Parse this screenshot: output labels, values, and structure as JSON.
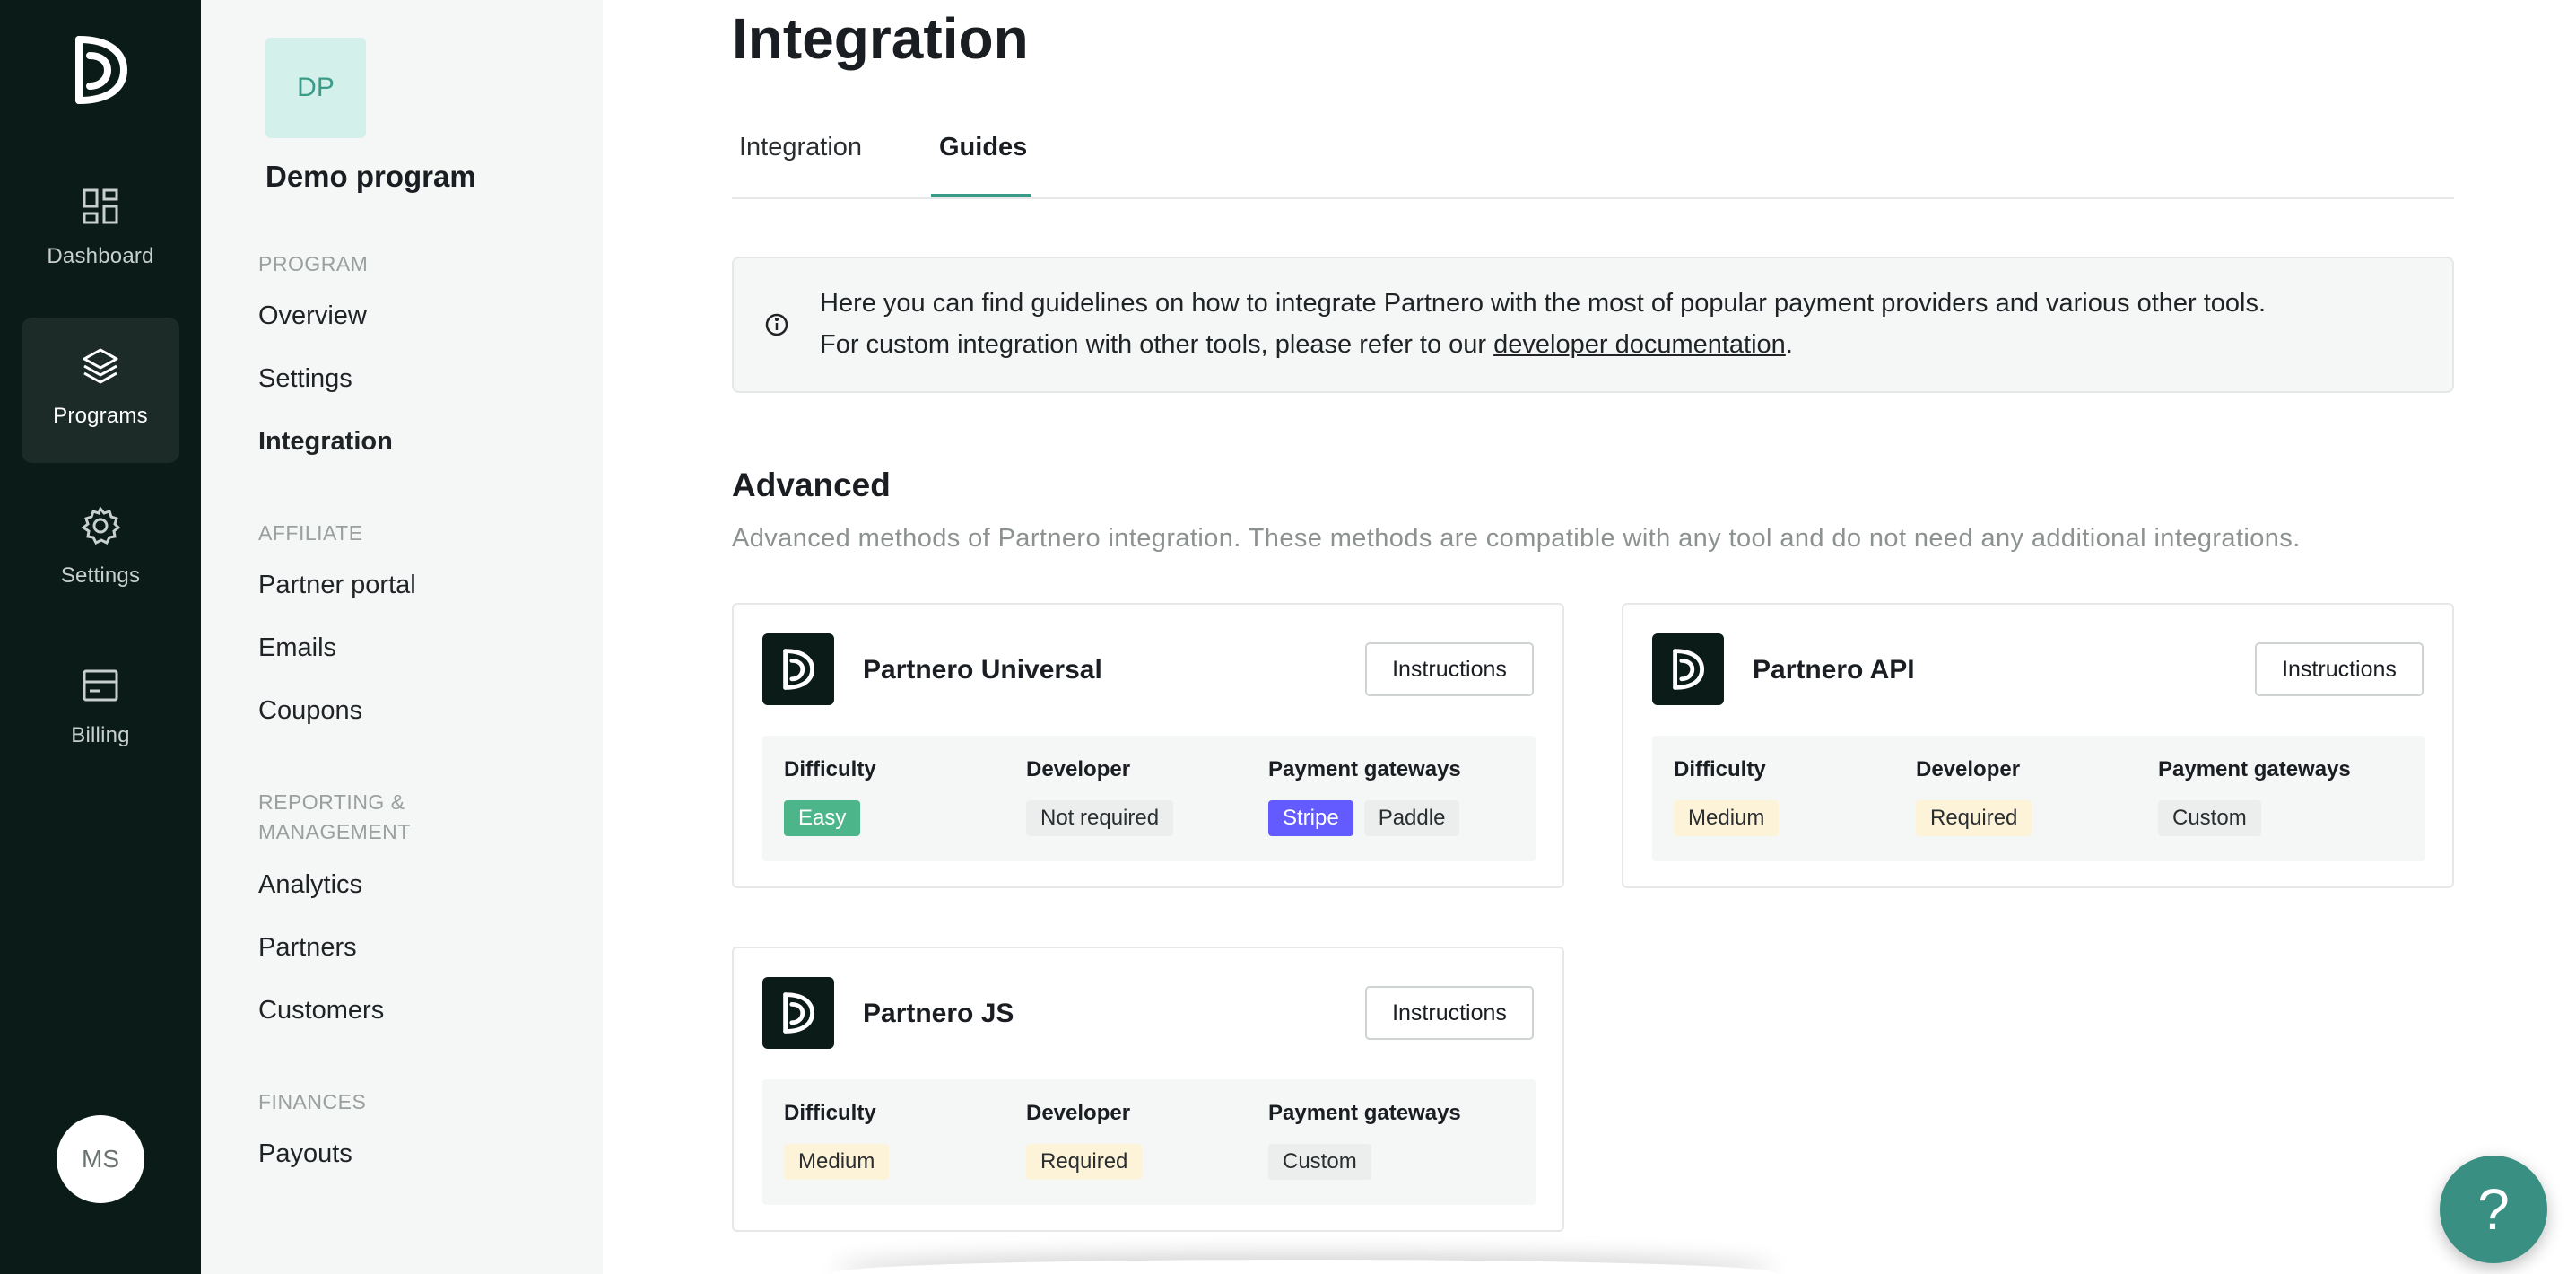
{
  "rail": {
    "items": [
      {
        "label": "Dashboard",
        "icon": "dashboard-icon"
      },
      {
        "label": "Programs",
        "icon": "layers-icon",
        "active": true
      },
      {
        "label": "Settings",
        "icon": "gear-icon"
      },
      {
        "label": "Billing",
        "icon": "billing-icon"
      }
    ],
    "avatar": "MS"
  },
  "program": {
    "badge": "DP",
    "name": "Demo program"
  },
  "subnav": {
    "sections": [
      {
        "title": "PROGRAM",
        "items": [
          "Overview",
          "Settings",
          "Integration"
        ]
      },
      {
        "title": "AFFILIATE",
        "items": [
          "Partner portal",
          "Emails",
          "Coupons"
        ]
      },
      {
        "title_line1": "REPORTING &",
        "title_line2": "MANAGEMENT",
        "items": [
          "Analytics",
          "Partners",
          "Customers"
        ]
      },
      {
        "title": "FINANCES",
        "items": [
          "Payouts"
        ]
      }
    ],
    "active_item": "Integration"
  },
  "main": {
    "title": "Integration",
    "tabs": [
      {
        "label": "Integration",
        "active": false
      },
      {
        "label": "Guides",
        "active": true
      }
    ],
    "notice": {
      "line1": "Here you can find guidelines on how to integrate Partnero with the most of popular payment providers and various other tools.",
      "line2_prefix": "For custom integration with other tools, please refer to our ",
      "link": "developer documentation",
      "line2_suffix": "."
    },
    "section": {
      "title": "Advanced",
      "description": "Advanced methods of Partnero integration. These methods are compatible with any tool and do not need any additional integrations."
    },
    "cards": [
      {
        "name": "Partnero Universal",
        "button": "Instructions",
        "difficulty_label": "Difficulty",
        "difficulty": "Easy",
        "developer_label": "Developer",
        "developer": "Not required",
        "gateways_label": "Payment gateways",
        "gateways": [
          "Stripe",
          "Paddle"
        ]
      },
      {
        "name": "Partnero API",
        "button": "Instructions",
        "difficulty_label": "Difficulty",
        "difficulty": "Medium",
        "developer_label": "Developer",
        "developer": "Required",
        "gateways_label": "Payment gateways",
        "gateways": [
          "Custom"
        ]
      },
      {
        "name": "Partnero JS",
        "button": "Instructions",
        "difficulty_label": "Difficulty",
        "difficulty": "Medium",
        "developer_label": "Developer",
        "developer": "Required",
        "gateways_label": "Payment gateways",
        "gateways": [
          "Custom"
        ]
      }
    ]
  },
  "help_button": "?",
  "colors": {
    "rail_bg": "#0b1b18",
    "accent": "#3a9c88",
    "easy": "#4cb58a",
    "stripe": "#635bff",
    "amber": "#fdf3d8"
  }
}
